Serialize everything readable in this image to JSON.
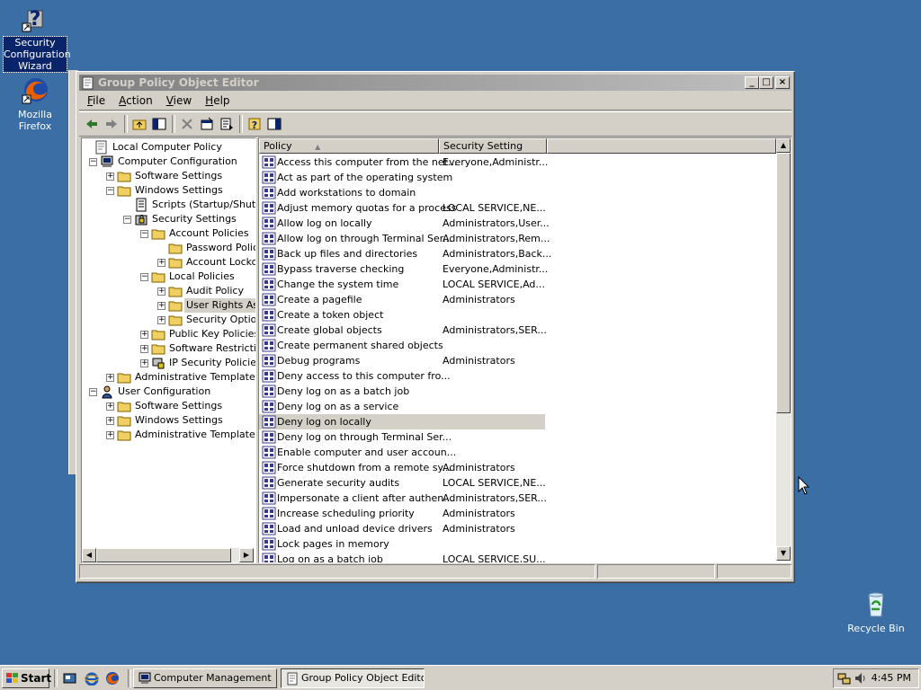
{
  "desktop": {
    "icons": [
      {
        "label": "Security Configuration Wizard",
        "icon": "security-wizard-icon"
      },
      {
        "label": "Mozilla Firefox",
        "icon": "firefox-icon"
      },
      {
        "label": "Recycle Bin",
        "icon": "recycle-bin-icon"
      }
    ]
  },
  "window": {
    "title": "Group Policy Object Editor",
    "controls": {
      "minimize": "_",
      "maximize": "□",
      "close": "×"
    }
  },
  "menu": [
    {
      "label": "File",
      "accel": "F",
      "rest": "ile"
    },
    {
      "label": "Action",
      "accel": "A",
      "rest": "ction"
    },
    {
      "label": "View",
      "accel": "V",
      "rest": "iew"
    },
    {
      "label": "Help",
      "accel": "H",
      "rest": "elp"
    }
  ],
  "toolbar": [
    "back-icon",
    "forward-icon",
    "up-folder-icon",
    "show-hide-tree-icon",
    "delete-icon",
    "properties-icon",
    "export-list-icon",
    "help-icon",
    "show-hide-action-pane-icon"
  ],
  "tree": [
    {
      "label": "Local Computer Policy",
      "level": 0,
      "expander": "",
      "icon": "policy-icon"
    },
    {
      "label": "Computer Configuration",
      "level": 1,
      "expander": "−",
      "icon": "computer-icon"
    },
    {
      "label": "Software Settings",
      "level": 2,
      "expander": "+",
      "icon": "folder-icon"
    },
    {
      "label": "Windows Settings",
      "level": 2,
      "expander": "−",
      "icon": "folder-icon"
    },
    {
      "label": "Scripts (Startup/Shutdown)",
      "level": 3,
      "expander": "",
      "icon": "script-icon"
    },
    {
      "label": "Security Settings",
      "level": 3,
      "expander": "−",
      "icon": "security-icon"
    },
    {
      "label": "Account Policies",
      "level": 4,
      "expander": "−",
      "icon": "folder-icon"
    },
    {
      "label": "Password Policy",
      "level": 5,
      "expander": "",
      "icon": "folder-icon"
    },
    {
      "label": "Account Lockout Policy",
      "level": 5,
      "expander": "+",
      "icon": "folder-icon"
    },
    {
      "label": "Local Policies",
      "level": 4,
      "expander": "−",
      "icon": "folder-icon"
    },
    {
      "label": "Audit Policy",
      "level": 5,
      "expander": "+",
      "icon": "folder-icon"
    },
    {
      "label": "User Rights Assignment",
      "level": 5,
      "expander": "+",
      "icon": "folder-icon",
      "selected": true
    },
    {
      "label": "Security Options",
      "level": 5,
      "expander": "+",
      "icon": "folder-icon"
    },
    {
      "label": "Public Key Policies",
      "level": 4,
      "expander": "+",
      "icon": "folder-icon"
    },
    {
      "label": "Software Restriction Policies",
      "level": 4,
      "expander": "+",
      "icon": "folder-icon"
    },
    {
      "label": "IP Security Policies on Local Computer",
      "level": 4,
      "expander": "+",
      "icon": "ip-security-icon"
    },
    {
      "label": "Administrative Templates",
      "level": 2,
      "expander": "+",
      "icon": "folder-icon"
    },
    {
      "label": "User Configuration",
      "level": 1,
      "expander": "−",
      "icon": "user-icon"
    },
    {
      "label": "Software Settings",
      "level": 2,
      "expander": "+",
      "icon": "folder-icon"
    },
    {
      "label": "Windows Settings",
      "level": 2,
      "expander": "+",
      "icon": "folder-icon"
    },
    {
      "label": "Administrative Templates",
      "level": 2,
      "expander": "+",
      "icon": "folder-icon"
    }
  ],
  "list": {
    "columns": [
      "Policy",
      "Security Setting"
    ],
    "sort_glyph": "▲",
    "rows": [
      {
        "policy": "Access this computer from the net...",
        "setting": "Everyone,Administr..."
      },
      {
        "policy": "Act as part of the operating system",
        "setting": ""
      },
      {
        "policy": "Add workstations to domain",
        "setting": ""
      },
      {
        "policy": "Adjust memory quotas for a process",
        "setting": "LOCAL SERVICE,NE..."
      },
      {
        "policy": "Allow log on locally",
        "setting": "Administrators,User..."
      },
      {
        "policy": "Allow log on through Terminal Ser...",
        "setting": "Administrators,Rem..."
      },
      {
        "policy": "Back up files and directories",
        "setting": "Administrators,Back..."
      },
      {
        "policy": "Bypass traverse checking",
        "setting": "Everyone,Administr..."
      },
      {
        "policy": "Change the system time",
        "setting": "LOCAL SERVICE,Ad..."
      },
      {
        "policy": "Create a pagefile",
        "setting": "Administrators"
      },
      {
        "policy": "Create a token object",
        "setting": ""
      },
      {
        "policy": "Create global objects",
        "setting": "Administrators,SER..."
      },
      {
        "policy": "Create permanent shared objects",
        "setting": ""
      },
      {
        "policy": "Debug programs",
        "setting": "Administrators"
      },
      {
        "policy": "Deny access to this computer fro...",
        "setting": ""
      },
      {
        "policy": "Deny log on as a batch job",
        "setting": ""
      },
      {
        "policy": "Deny log on as a service",
        "setting": ""
      },
      {
        "policy": "Deny log on locally",
        "setting": "",
        "selected": true
      },
      {
        "policy": "Deny log on through Terminal Ser...",
        "setting": ""
      },
      {
        "policy": "Enable computer and user accoun...",
        "setting": ""
      },
      {
        "policy": "Force shutdown from a remote sy...",
        "setting": "Administrators"
      },
      {
        "policy": "Generate security audits",
        "setting": "LOCAL SERVICE,NE..."
      },
      {
        "policy": "Impersonate a client after authen...",
        "setting": "Administrators,SER..."
      },
      {
        "policy": "Increase scheduling priority",
        "setting": "Administrators"
      },
      {
        "policy": "Load and unload device drivers",
        "setting": "Administrators"
      },
      {
        "policy": "Lock pages in memory",
        "setting": ""
      },
      {
        "policy": "Log on as a batch job",
        "setting": "LOCAL SERVICE,SU..."
      }
    ]
  },
  "taskbar": {
    "start_label": "Start",
    "quick_launch": [
      "show-desktop-icon",
      "internet-explorer-icon",
      "firefox-icon"
    ],
    "tasks": [
      {
        "label": "Computer Management",
        "icon": "computer-management-icon",
        "active": false
      },
      {
        "label": "Group Policy Object Editor",
        "icon": "policy-icon",
        "active": true
      }
    ],
    "tray_icons": [
      "network-icon",
      "volume-icon"
    ],
    "clock": "4:45 PM"
  }
}
